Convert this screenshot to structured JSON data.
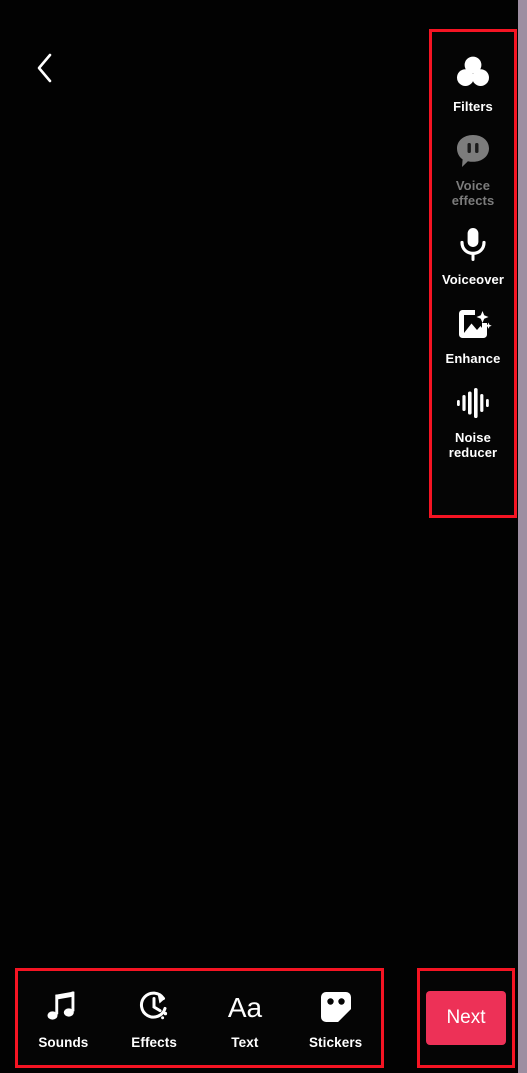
{
  "screen": {
    "name": "video-editor-screen",
    "background_color": "#020202",
    "annotation_color": "#f51423"
  },
  "header": {
    "back_icon": "chevron-left-icon"
  },
  "tool_rail": {
    "items": [
      {
        "label": "Filters",
        "icon": "filters-icon",
        "disabled": false
      },
      {
        "label": "Voice\neffects",
        "label_line1": "Voice",
        "label_line2": "effects",
        "icon": "voice-effects-icon",
        "disabled": true
      },
      {
        "label": "Voiceover",
        "icon": "microphone-icon",
        "disabled": false
      },
      {
        "label": "Enhance",
        "icon": "enhance-image-icon",
        "disabled": false
      },
      {
        "label": "Noise\nreducer",
        "label_line1": "Noise",
        "label_line2": "reducer",
        "icon": "noise-reducer-icon",
        "disabled": false
      }
    ]
  },
  "bottom_toolbar": {
    "items": [
      {
        "label": "Sounds",
        "icon": "music-note-icon"
      },
      {
        "label": "Effects",
        "icon": "clock-rotate-icon"
      },
      {
        "label": "Text",
        "icon": "text-aa-icon"
      },
      {
        "label": "Stickers",
        "icon": "sticker-icon"
      }
    ]
  },
  "next": {
    "label": "Next",
    "color": "#ed3157"
  }
}
